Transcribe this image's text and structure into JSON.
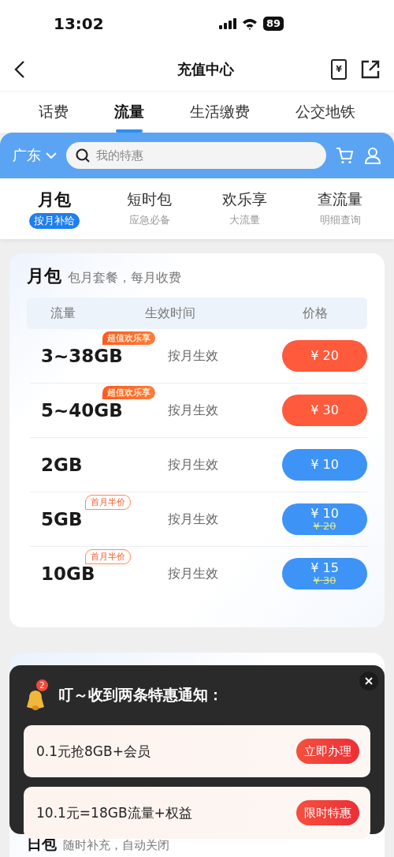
{
  "status_bar": {
    "time": "13:02",
    "battery": "89"
  },
  "nav": {
    "title": "充值中心",
    "bill_symbol": "¥"
  },
  "tabs": [
    {
      "label": "话费",
      "selected": false
    },
    {
      "label": "流量",
      "selected": true
    },
    {
      "label": "生活缴费",
      "selected": false
    },
    {
      "label": "公交地铁",
      "selected": false
    }
  ],
  "toolbar": {
    "region": "广东",
    "search_placeholder": "我的特惠"
  },
  "sub_tabs": [
    {
      "label": "月包",
      "caption": "按月补给",
      "selected": true
    },
    {
      "label": "短时包",
      "caption": "应急必备",
      "selected": false
    },
    {
      "label": "欢乐享",
      "caption": "大流量",
      "selected": false
    },
    {
      "label": "查流量",
      "caption": "明细查询",
      "selected": false
    }
  ],
  "monthly_card": {
    "title": "月包",
    "subtitle": "包月套餐，每月收费",
    "columns": [
      "流量",
      "生效时间",
      "价格"
    ],
    "rows": [
      {
        "data": "3~38GB",
        "badge": {
          "text": "超值欢乐享",
          "kind": "filled"
        },
        "effective": "按月生效",
        "price": "¥ 20",
        "color": "#ff5a3c"
      },
      {
        "data": "5~40GB",
        "badge": {
          "text": "超值欢乐享",
          "kind": "filled"
        },
        "effective": "按月生效",
        "price": "¥ 30",
        "color": "#ff5a3c"
      },
      {
        "data": "2GB",
        "effective": "按月生效",
        "price": "¥ 10",
        "color": "#3d94f6"
      },
      {
        "data": "5GB",
        "badge": {
          "text": "首月半价",
          "kind": "outline"
        },
        "effective": "按月生效",
        "price": "¥ 10",
        "original_price": "¥ 20",
        "color": "#3d94f6"
      },
      {
        "data": "10GB",
        "badge": {
          "text": "首月半价",
          "kind": "outline"
        },
        "effective": "按月生效",
        "price": "¥ 15",
        "original_price": "¥ 30",
        "color": "#3d94f6"
      }
    ]
  },
  "daily_card": {
    "title": "日包",
    "subtitle": "随时补充，自动关闭"
  },
  "popup": {
    "badge_count": "2",
    "title": "叮～收到两条特惠通知：",
    "offers": [
      {
        "text": "0.1元抢8GB+会员",
        "action": "立即办理"
      },
      {
        "text": "10.1元=18GB流量+权益",
        "action": "限时特惠"
      }
    ]
  }
}
